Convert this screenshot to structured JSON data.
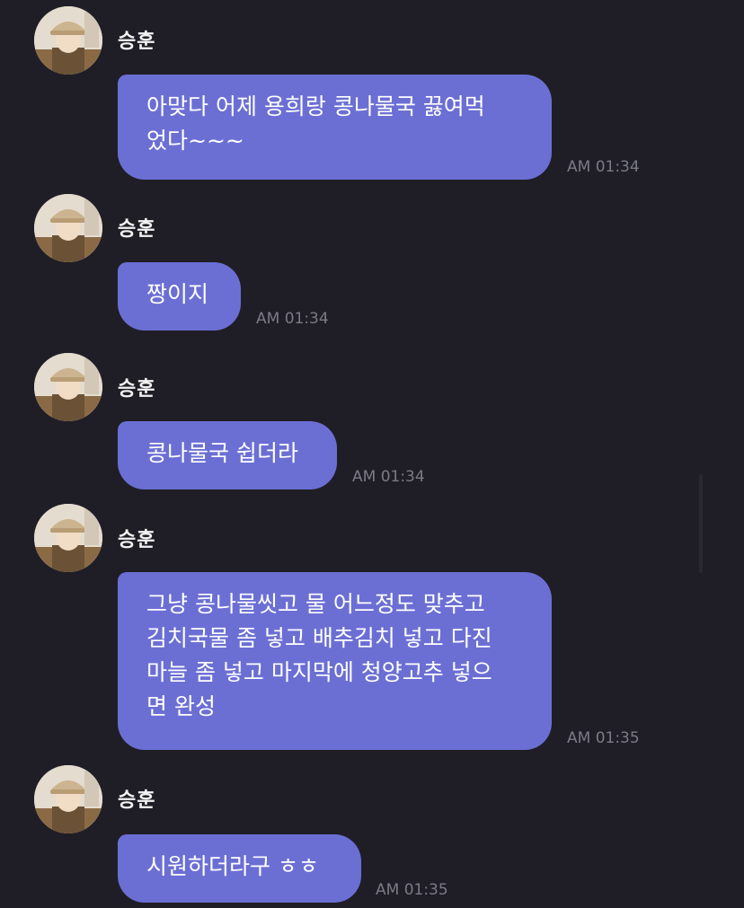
{
  "messages": [
    {
      "sender": "승훈",
      "text": "아맞다 어제 용희랑 콩나물국 끓여먹\n었다~~~",
      "time": "AM 01:34"
    },
    {
      "sender": "승훈",
      "text": "짱이지",
      "time": "AM 01:34"
    },
    {
      "sender": "승훈",
      "text": "콩나물국 쉽더라",
      "time": "AM 01:34"
    },
    {
      "sender": "승훈",
      "text": "그냥 콩나물씻고 물 어느정도 맞추고\n김치국물 좀 넣고 배추김치 넣고 다진\n마늘 좀 넣고 마지막에 청양고추 넣으\n면 완성",
      "time": "AM 01:35"
    },
    {
      "sender": "승훈",
      "text": "시원하더라구 ㅎㅎ",
      "time": "AM 01:35"
    }
  ],
  "colors": {
    "background": "#1f1e26",
    "bubble": "#6b6fd4",
    "name": "#f2f2f4",
    "timestamp": "#7b7b85"
  },
  "icons": {
    "avatar": "profile-photo"
  }
}
